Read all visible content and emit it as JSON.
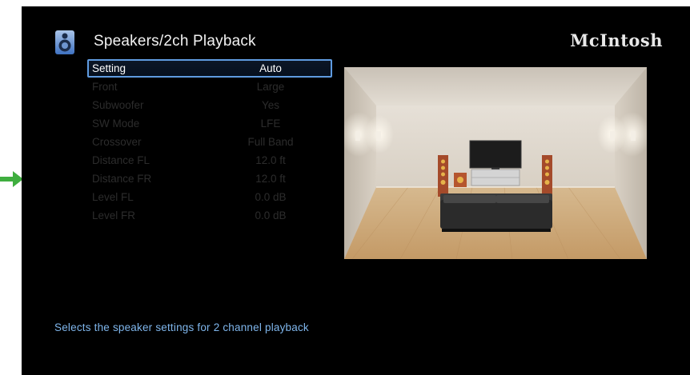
{
  "header": {
    "title": "Speakers/2ch Playback",
    "brand": "McIntosh",
    "icon": "speaker-icon"
  },
  "menu": {
    "items": [
      {
        "label": "Setting",
        "value": "Auto",
        "selected": true
      },
      {
        "label": "Front",
        "value": "Large",
        "selected": false
      },
      {
        "label": "Subwoofer",
        "value": "Yes",
        "selected": false
      },
      {
        "label": "SW Mode",
        "value": "LFE",
        "selected": false
      },
      {
        "label": "Crossover",
        "value": "Full Band",
        "selected": false
      },
      {
        "label": "Distance FL",
        "value": "12.0 ft",
        "selected": false
      },
      {
        "label": "Distance FR",
        "value": "12.0 ft",
        "selected": false
      },
      {
        "label": "Level FL",
        "value": "0.0 dB",
        "selected": false
      },
      {
        "label": "Level FR",
        "value": "0.0 dB",
        "selected": false
      }
    ]
  },
  "footer": {
    "help_text": "Selects the speaker settings for 2 channel playback"
  },
  "colors": {
    "background": "#000000",
    "selection_border": "#5f9be0",
    "help_text": "#7fb6ec",
    "dim_text": "#2c2c2c",
    "pointer_arrow": "#3fae3f"
  },
  "illustration": {
    "icon": "living-room-speaker-layout-image"
  }
}
